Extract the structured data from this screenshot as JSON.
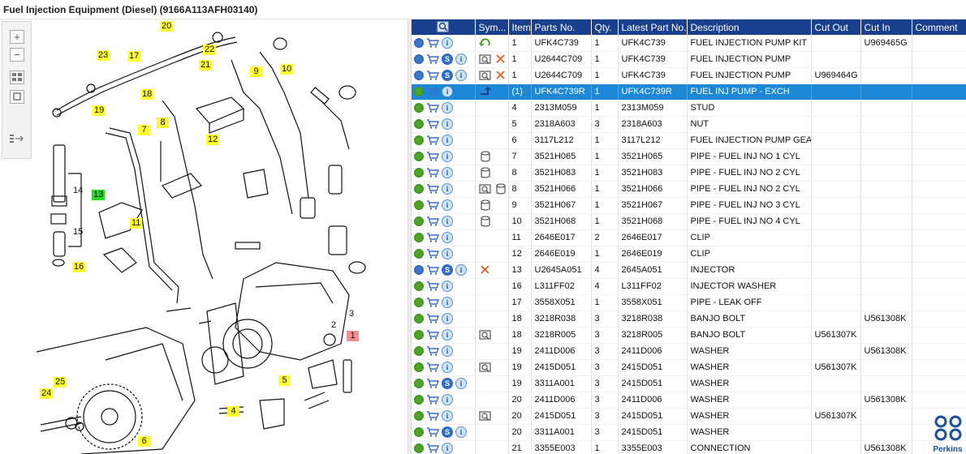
{
  "window": {
    "title": "Fuel Injection Equipment (Diesel) (9166A113AFH03140)"
  },
  "toolbox": [
    {
      "name": "zoom-in-button",
      "icon": "plus-icon"
    },
    {
      "name": "zoom-out-button",
      "icon": "minus-icon"
    },
    {
      "name": "fit-view-button",
      "icon": "grid-icon"
    },
    {
      "name": "actual-size-button",
      "icon": "square-icon"
    },
    {
      "name": "toggle-panel-button",
      "icon": "list-arrow-icon"
    }
  ],
  "callouts": [
    "20",
    "23",
    "17",
    "22",
    "21",
    "9",
    "10",
    "19",
    "18",
    "7",
    "8",
    "12",
    "14",
    "13",
    "11",
    "15",
    "16",
    "3",
    "2",
    "1",
    "5",
    "4",
    "25",
    "24",
    "6"
  ],
  "table": {
    "columns": [
      "",
      "Sym...",
      "Item",
      "Parts No.",
      "Qty.",
      "Latest Part No.",
      "Description",
      "Cut Out",
      "Cut In",
      "Comment"
    ],
    "rows": [
      {
        "icons": [
          "gear-blue",
          "cart",
          "info"
        ],
        "sym": [
          "replace-icon"
        ],
        "item": "1",
        "part": "UFK4C739",
        "qty": "1",
        "latest": "UFK4C739",
        "desc": "FUEL INJECTION PUMP KIT",
        "cutout": "",
        "cutin": "U969465G",
        "comment": ""
      },
      {
        "icons": [
          "gear-blue",
          "cart",
          "s",
          "info"
        ],
        "sym": [
          "illustration-icon",
          "delete-icon"
        ],
        "item": "1",
        "part": "U2644C709",
        "qty": "1",
        "latest": "UFK4C739",
        "desc": "FUEL INJECTION PUMP",
        "cutout": "",
        "cutin": "",
        "comment": ""
      },
      {
        "icons": [
          "gear-blue",
          "cart",
          "s",
          "info"
        ],
        "sym": [
          "illustration-icon",
          "delete-icon"
        ],
        "item": "1",
        "part": "U2644C709",
        "qty": "1",
        "latest": "UFK4C739",
        "desc": "FUEL INJECTION PUMP",
        "cutout": "U969464G",
        "cutin": "",
        "comment": ""
      },
      {
        "icons": [
          "gear",
          "cart",
          "info"
        ],
        "sym": [
          "exchange-icon"
        ],
        "item": "(1)",
        "part": "UFK4C739R",
        "qty": "1",
        "latest": "UFK4C739R",
        "desc": "FUEL INJ PUMP - EXCH",
        "cutout": "",
        "cutin": "",
        "comment": "",
        "selected": true
      },
      {
        "icons": [
          "gear",
          "cart",
          "info"
        ],
        "sym": [],
        "item": "4",
        "part": "2313M059",
        "qty": "1",
        "latest": "2313M059",
        "desc": "STUD",
        "cutout": "",
        "cutin": "",
        "comment": ""
      },
      {
        "icons": [
          "gear",
          "cart",
          "info"
        ],
        "sym": [],
        "item": "5",
        "part": "2318A603",
        "qty": "3",
        "latest": "2318A603",
        "desc": "NUT",
        "cutout": "",
        "cutin": "",
        "comment": ""
      },
      {
        "icons": [
          "gear",
          "cart",
          "info"
        ],
        "sym": [],
        "item": "6",
        "part": "3117L212",
        "qty": "1",
        "latest": "3117L212",
        "desc": "FUEL INJECTION PUMP GEAR",
        "cutout": "",
        "cutin": "",
        "comment": ""
      },
      {
        "icons": [
          "gear",
          "cart",
          "info"
        ],
        "sym": [
          "cylinder-icon"
        ],
        "item": "7",
        "part": "3521H065",
        "qty": "1",
        "latest": "3521H065",
        "desc": "PIPE - FUEL INJ NO 1 CYL",
        "cutout": "",
        "cutin": "",
        "comment": ""
      },
      {
        "icons": [
          "gear",
          "cart",
          "info"
        ],
        "sym": [
          "cylinder-icon"
        ],
        "item": "8",
        "part": "3521H083",
        "qty": "1",
        "latest": "3521H083",
        "desc": "PIPE - FUEL INJ NO 2 CYL",
        "cutout": "",
        "cutin": "",
        "comment": ""
      },
      {
        "icons": [
          "gear",
          "cart",
          "info"
        ],
        "sym": [
          "illustration-icon",
          "cylinder-icon"
        ],
        "item": "8",
        "part": "3521H066",
        "qty": "1",
        "latest": "3521H066",
        "desc": "PIPE - FUEL INJ NO 2 CYL",
        "cutout": "",
        "cutin": "",
        "comment": ""
      },
      {
        "icons": [
          "gear",
          "cart",
          "info"
        ],
        "sym": [
          "cylinder-icon"
        ],
        "item": "9",
        "part": "3521H067",
        "qty": "1",
        "latest": "3521H067",
        "desc": "PIPE - FUEL INJ NO 3 CYL",
        "cutout": "",
        "cutin": "",
        "comment": ""
      },
      {
        "icons": [
          "gear",
          "cart",
          "info"
        ],
        "sym": [
          "cylinder-icon"
        ],
        "item": "10",
        "part": "3521H068",
        "qty": "1",
        "latest": "3521H068",
        "desc": "PIPE - FUEL INJ NO 4 CYL",
        "cutout": "",
        "cutin": "",
        "comment": ""
      },
      {
        "icons": [
          "gear",
          "cart",
          "info"
        ],
        "sym": [],
        "item": "11",
        "part": "2646E017",
        "qty": "2",
        "latest": "2646E017",
        "desc": "CLIP",
        "cutout": "",
        "cutin": "",
        "comment": ""
      },
      {
        "icons": [
          "gear",
          "cart",
          "info"
        ],
        "sym": [],
        "item": "12",
        "part": "2646E019",
        "qty": "1",
        "latest": "2646E019",
        "desc": "CLIP",
        "cutout": "",
        "cutin": "",
        "comment": ""
      },
      {
        "icons": [
          "gear-blue",
          "cart",
          "s",
          "info"
        ],
        "sym": [
          "delete-icon"
        ],
        "item": "13",
        "part": "U2645A051",
        "qty": "4",
        "latest": "2645A051",
        "desc": "INJECTOR",
        "cutout": "",
        "cutin": "",
        "comment": ""
      },
      {
        "icons": [
          "gear",
          "cart",
          "info"
        ],
        "sym": [],
        "item": "16",
        "part": "L311FF02",
        "qty": "4",
        "latest": "L311FF02",
        "desc": "INJECTOR WASHER",
        "cutout": "",
        "cutin": "",
        "comment": ""
      },
      {
        "icons": [
          "gear",
          "cart",
          "info"
        ],
        "sym": [],
        "item": "17",
        "part": "3558X051",
        "qty": "1",
        "latest": "3558X051",
        "desc": "PIPE - LEAK OFF",
        "cutout": "",
        "cutin": "",
        "comment": ""
      },
      {
        "icons": [
          "gear",
          "cart",
          "info"
        ],
        "sym": [],
        "item": "18",
        "part": "3218R038",
        "qty": "3",
        "latest": "3218R038",
        "desc": "BANJO BOLT",
        "cutout": "",
        "cutin": "U561308K",
        "comment": ""
      },
      {
        "icons": [
          "gear",
          "cart",
          "info"
        ],
        "sym": [
          "illustration-icon"
        ],
        "item": "18",
        "part": "3218R005",
        "qty": "3",
        "latest": "3218R005",
        "desc": "BANJO BOLT",
        "cutout": "U561307K",
        "cutin": "",
        "comment": ""
      },
      {
        "icons": [
          "gear",
          "cart",
          "info"
        ],
        "sym": [],
        "item": "19",
        "part": "2411D006",
        "qty": "3",
        "latest": "2411D006",
        "desc": "WASHER",
        "cutout": "",
        "cutin": "U561308K",
        "comment": ""
      },
      {
        "icons": [
          "gear",
          "cart",
          "info"
        ],
        "sym": [
          "illustration-icon"
        ],
        "item": "19",
        "part": "2415D051",
        "qty": "3",
        "latest": "2415D051",
        "desc": "WASHER",
        "cutout": "U561307K",
        "cutin": "",
        "comment": ""
      },
      {
        "icons": [
          "gear",
          "cart",
          "s",
          "info"
        ],
        "sym": [],
        "item": "19",
        "part": "3311A001",
        "qty": "3",
        "latest": "2415D051",
        "desc": "WASHER",
        "cutout": "",
        "cutin": "",
        "comment": ""
      },
      {
        "icons": [
          "gear",
          "cart",
          "info"
        ],
        "sym": [],
        "item": "20",
        "part": "2411D006",
        "qty": "3",
        "latest": "2411D006",
        "desc": "WASHER",
        "cutout": "",
        "cutin": "U561308K",
        "comment": ""
      },
      {
        "icons": [
          "gear",
          "cart",
          "info"
        ],
        "sym": [
          "illustration-icon"
        ],
        "item": "20",
        "part": "2415D051",
        "qty": "3",
        "latest": "2415D051",
        "desc": "WASHER",
        "cutout": "U561307K",
        "cutin": "",
        "comment": ""
      },
      {
        "icons": [
          "gear",
          "cart",
          "s",
          "info"
        ],
        "sym": [],
        "item": "20",
        "part": "3311A001",
        "qty": "3",
        "latest": "2415D051",
        "desc": "WASHER",
        "cutout": "",
        "cutin": "",
        "comment": ""
      },
      {
        "icons": [
          "gear",
          "cart",
          "info"
        ],
        "sym": [],
        "item": "21",
        "part": "3355E003",
        "qty": "1",
        "latest": "3355E003",
        "desc": "CONNECTION",
        "cutout": "",
        "cutin": "U561308K",
        "comment": ""
      }
    ]
  },
  "brand": {
    "name": "Perkins",
    "color": "#1a4f9c"
  },
  "colors": {
    "header": "#1a3f8c",
    "selected": "#1e88d8",
    "callout": "#ffff33",
    "callout_green": "#22dd22",
    "callout_red": "#ff8c8c"
  }
}
